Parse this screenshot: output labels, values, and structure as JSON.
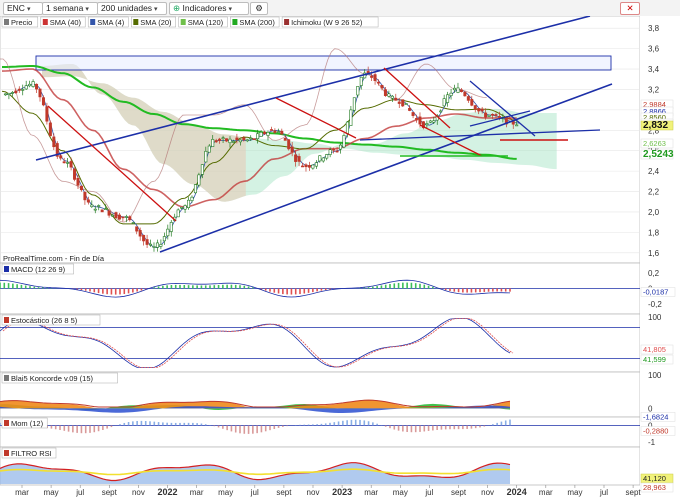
{
  "toolbar": {
    "symbol": "ENC",
    "interval": "1 semana",
    "units": "200 unidades",
    "indicators_button": "Indicadores",
    "nav_left": "◂",
    "nav_right": "▸",
    "icon_names": [
      "chevron-down-icon",
      "settings-icon",
      "camera-icon",
      "close-icon"
    ]
  },
  "legend": {
    "items": [
      {
        "label": "Precio",
        "color": "#7a7a7a"
      },
      {
        "label": "SMA (40)",
        "color": "#cc3333"
      },
      {
        "label": "SMA (4)",
        "color": "#3355aa"
      },
      {
        "label": "SMA (20)",
        "color": "#556b00"
      },
      {
        "label": "SMA (120)",
        "color": "#6fbf4a"
      },
      {
        "label": "SMA (200)",
        "color": "#22aa22"
      },
      {
        "label": "Ichimoku (W 9 26 52)",
        "color": "#9a3030"
      }
    ]
  },
  "source_label": "ProRealTime.com - Fin de Día",
  "panel_titles": {
    "macd": "MACD (12 26 9)",
    "stoch": "Estocástico (26 8 5)",
    "koncorde": "Blai5 Koncorde v.09 (15)",
    "mom": "Mom (12)",
    "rsi": "FILTRO RSI"
  },
  "x_axis_labels": [
    "mar",
    "may",
    "jul",
    "sept",
    "nov",
    "2022",
    "mar",
    "may",
    "jul",
    "sept",
    "nov",
    "2023",
    "mar",
    "may",
    "jul",
    "sept",
    "nov",
    "2024",
    "mar",
    "may",
    "jul",
    "sept"
  ],
  "colors": {
    "price_up": "#1f7a1f",
    "price_down": "#c0392b",
    "trend_blue": "#1c2fa8",
    "resistance_red": "#cc1111",
    "sma200": "#22bb22",
    "sma40": "#c23b3b",
    "kumo_green": "#9fe3c0",
    "kumo_red": "#e8c9b5",
    "panel_bg": "#ffffff",
    "grid": "#e6e6e6"
  },
  "chart_data": [
    {
      "type": "line",
      "panel": "price",
      "title": "",
      "y_ticks": [
        1.6,
        1.8,
        2.0,
        2.2,
        2.4,
        2.6,
        2.8,
        3.0,
        3.2,
        3.4,
        3.6,
        3.8
      ],
      "ylim": [
        1.5,
        3.9
      ],
      "x": [
        "mar",
        "may",
        "jul",
        "sept",
        "nov",
        "2022",
        "mar",
        "may",
        "jul",
        "sept",
        "nov",
        "2023",
        "mar",
        "may",
        "jul",
        "sept",
        "nov",
        "2024"
      ],
      "series": [
        {
          "name": "Precio",
          "values": [
            3.15,
            3.25,
            2.5,
            2.05,
            1.95,
            1.65,
            2.05,
            2.7,
            2.7,
            2.8,
            2.45,
            2.6,
            3.35,
            3.1,
            2.85,
            3.2,
            2.95,
            2.87
          ]
        },
        {
          "name": "SMA (200)",
          "values": [
            3.42,
            3.43,
            3.36,
            3.22,
            3.08,
            2.96,
            2.86,
            2.82,
            2.8,
            2.77,
            2.72,
            2.68,
            2.66,
            2.64,
            2.61,
            2.58,
            2.56,
            2.52
          ]
        },
        {
          "name": "SMA (40)",
          "values": [
            3.38,
            3.4,
            3.1,
            2.8,
            2.42,
            2.22,
            2.05,
            2.12,
            2.3,
            2.52,
            2.62,
            2.62,
            2.72,
            2.84,
            2.92,
            2.96,
            2.92,
            2.92
          ]
        }
      ],
      "value_labels": [
        "2,9884",
        "2,8866",
        "2,8560",
        "2,8750",
        "2,832",
        "2,6263",
        "2,5243"
      ],
      "annotations": []
    },
    {
      "type": "bar",
      "panel": "MACD (12 26 9)",
      "y_ticks": [
        0.2,
        0,
        -0.2
      ],
      "ylim": [
        -0.3,
        0.3
      ],
      "value_labels": [
        "-0,0187"
      ]
    },
    {
      "type": "line",
      "panel": "Estocástico (26 8 5)",
      "y_ticks": [
        100
      ],
      "ylim": [
        0,
        100
      ],
      "value_labels": [
        "41,805",
        "41,599"
      ]
    },
    {
      "type": "area",
      "panel": "Blai5 Koncorde v.09 (15)",
      "y_ticks": [
        100,
        0
      ],
      "ylim": [
        -20,
        100
      ],
      "value_labels": [
        "-1,6824"
      ]
    },
    {
      "type": "bar",
      "panel": "Mom (12)",
      "y_ticks": [
        0,
        -1
      ],
      "ylim": [
        -1.2,
        0.4
      ],
      "value_labels": [
        "-0,2880"
      ]
    },
    {
      "type": "area",
      "panel": "FILTRO RSI",
      "y_ticks": [],
      "ylim": [
        0,
        100
      ],
      "value_labels": [
        "41,120",
        "28,963"
      ]
    }
  ]
}
